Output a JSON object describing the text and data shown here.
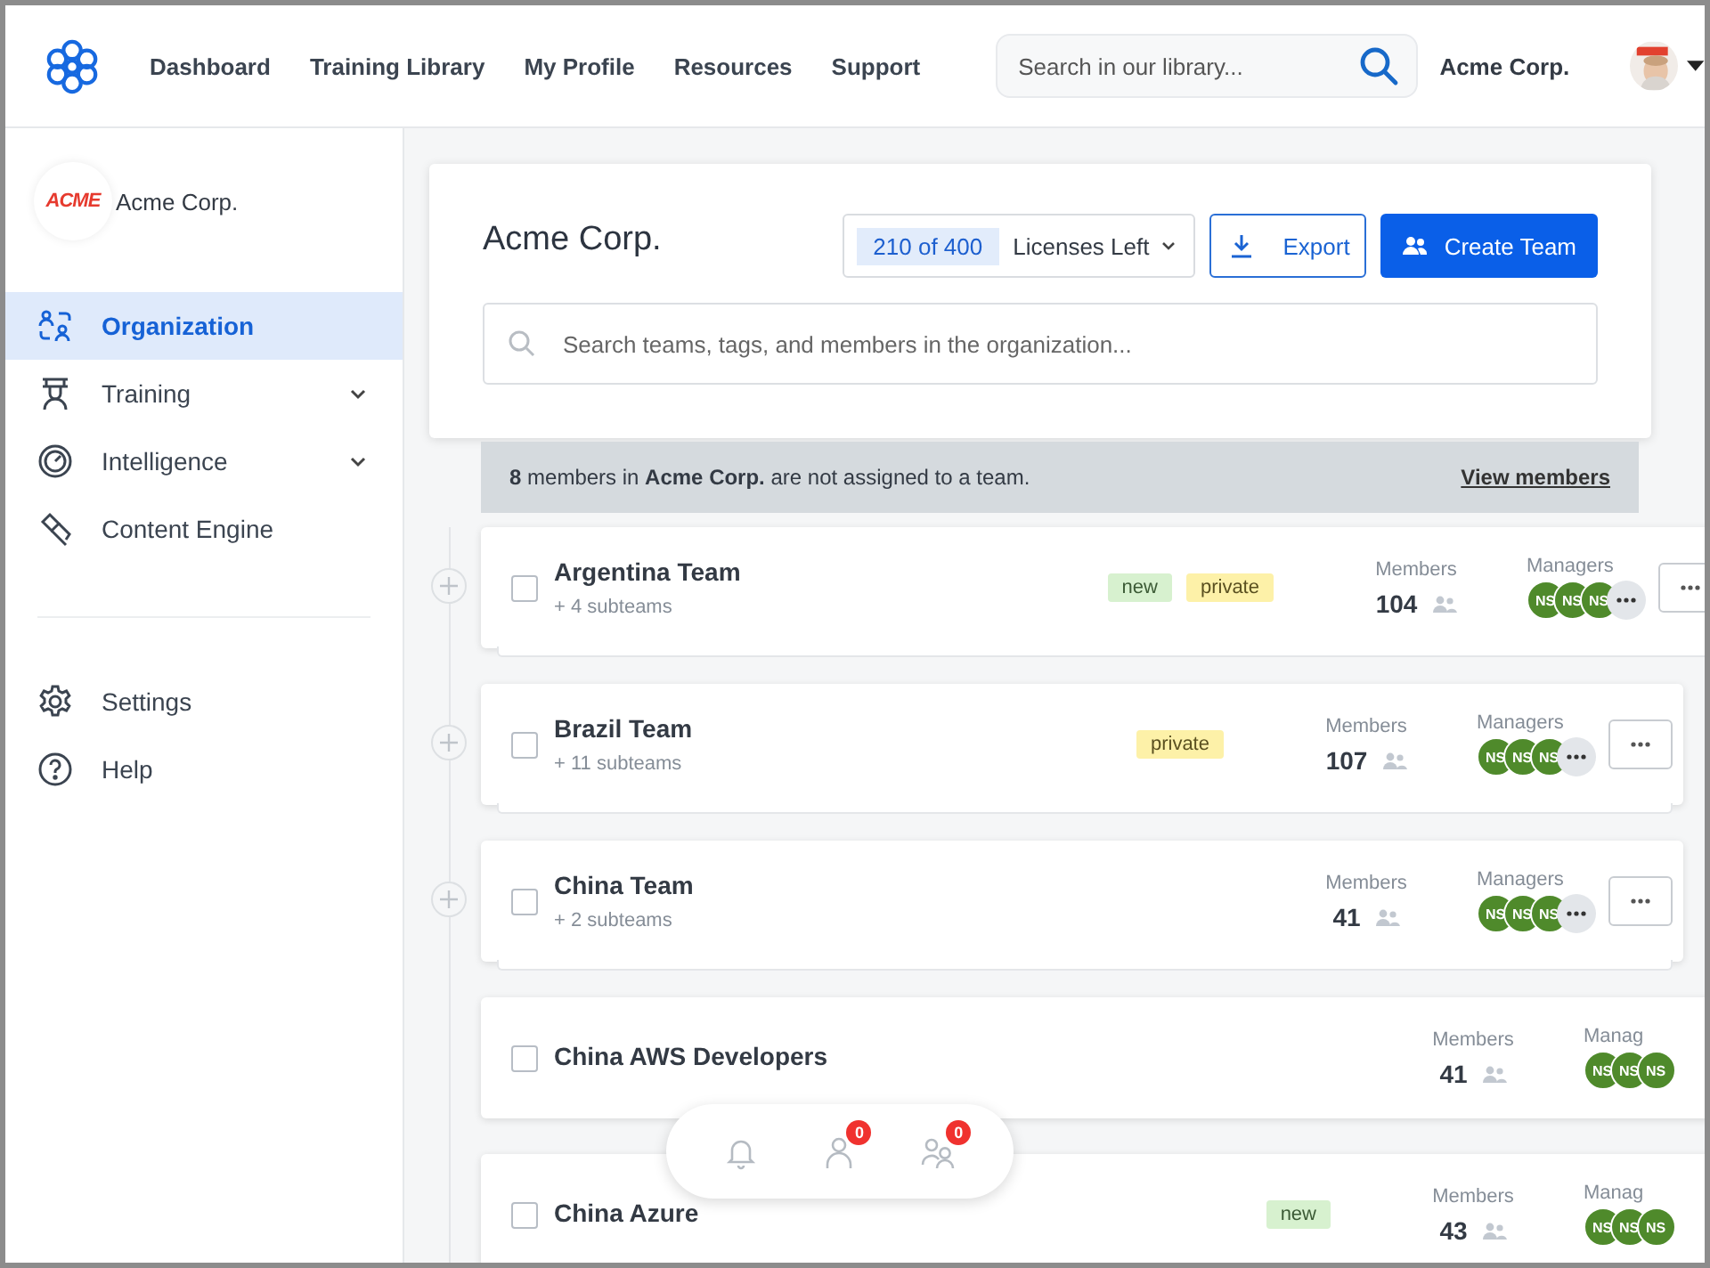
{
  "topnav": {
    "items": [
      {
        "label": "Dashboard"
      },
      {
        "label": "Training Library"
      },
      {
        "label": "My Profile"
      },
      {
        "label": "Resources"
      },
      {
        "label": "Support"
      }
    ],
    "search": {
      "placeholder": "Search in our library..."
    },
    "org_name": "Acme Corp."
  },
  "sidebar": {
    "org": {
      "logo_text": "ACME",
      "name": "Acme Corp."
    },
    "items": [
      {
        "label": "Organization",
        "selected": true,
        "expandable": false
      },
      {
        "label": "Training",
        "selected": false,
        "expandable": true
      },
      {
        "label": "Intelligence",
        "selected": false,
        "expandable": true
      },
      {
        "label": "Content Engine",
        "selected": false,
        "expandable": false
      }
    ],
    "bottom_items": [
      {
        "label": "Settings",
        "selected": false
      },
      {
        "label": "Help",
        "selected": false
      }
    ]
  },
  "header": {
    "title": "Acme Corp.",
    "licenses": {
      "count": "210 of 400",
      "label": "Licenses Left"
    },
    "export": "Export",
    "create": "Create Team",
    "search": {
      "placeholder": "Search teams, tags, and members in the organization..."
    }
  },
  "banner": {
    "text": "**8** members in **Acme Corp.** are not assigned to a team.",
    "link": "View members"
  },
  "teams": [
    {
      "name": "Argentina Team",
      "checked": false,
      "subteams": "+ 4 subteams",
      "tags": [
        {
          "label": "new",
          "kind": "new"
        },
        {
          "label": "private",
          "kind": "private"
        }
      ],
      "members_label": "Members",
      "members": "104",
      "managers_label": "Managers",
      "managers": [
        "NS",
        "NS",
        "NS"
      ],
      "more_managers": true,
      "expandable": true
    },
    {
      "name": "Brazil Team",
      "checked": false,
      "subteams": "+ 11 subteams",
      "tags": [
        {
          "label": "private",
          "kind": "private"
        }
      ],
      "members_label": "Members",
      "members": "107",
      "managers_label": "Managers",
      "managers": [
        "NS",
        "NS",
        "NS"
      ],
      "more_managers": true,
      "expandable": true
    },
    {
      "name": "China Team",
      "checked": false,
      "subteams": "+ 2 subteams",
      "members_label": "Members",
      "members": "41",
      "managers_label": "Managers",
      "managers": [
        "NS",
        "NS",
        "NS"
      ],
      "more_managers": true,
      "expandable": true
    },
    {
      "name": "China AWS Developers",
      "checked": false,
      "members_label": "Members",
      "members": "41",
      "managers_label": "Manag",
      "managers": [
        "NS",
        "NS",
        "NS"
      ],
      "more_managers": false,
      "expandable": false
    },
    {
      "name": "China Azure",
      "checked": false,
      "tags": [
        {
          "label": "new",
          "kind": "new"
        }
      ],
      "members_label": "Members",
      "members": "43",
      "managers_label": "Manag",
      "managers": [
        "NS",
        "NS",
        "NS"
      ],
      "more_managers": false,
      "expandable": false
    }
  ],
  "notification_badges": [
    "0",
    "0"
  ]
}
